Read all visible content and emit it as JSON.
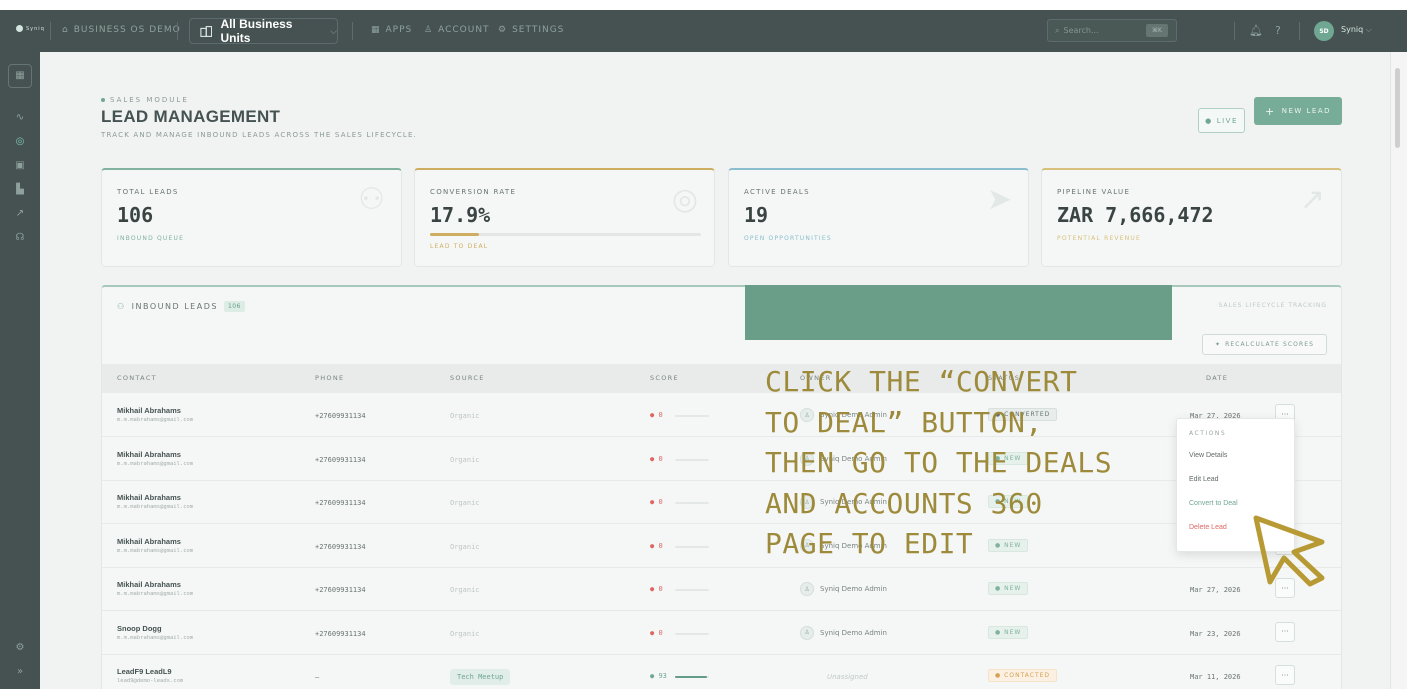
{
  "topbar": {
    "logo_text": "Syniq",
    "org_label": "BUSINESS OS DEMO",
    "business_unit": "All Business Units",
    "nav": [
      {
        "icon": "grid-icon",
        "label": "APPS"
      },
      {
        "icon": "user-icon",
        "label": "ACCOUNT"
      },
      {
        "icon": "gear-icon",
        "label": "SETTINGS"
      }
    ],
    "search_placeholder": "Search...",
    "search_shortcut": "⌘K",
    "avatar_initials": "SD",
    "user_name": "Syniq"
  },
  "sidebar": {
    "items": [
      "apps-grid-icon",
      "activity-icon",
      "target-icon",
      "wallet-icon",
      "chart-icon",
      "trend-icon",
      "headset-icon"
    ],
    "footer": [
      "gear-icon",
      "expand-icon"
    ]
  },
  "page": {
    "eyebrow": "SALES MODULE",
    "title": "LEAD MANAGEMENT",
    "subtitle": "TRACK AND MANAGE INBOUND LEADS ACROSS THE SALES LIFECYCLE.",
    "live_label": "LIVE",
    "new_lead_label": "NEW LEAD"
  },
  "stats": [
    {
      "label": "TOTAL LEADS",
      "value": "106",
      "caption": "INBOUND QUEUE",
      "accent": "#6fa892",
      "icon": "users-icon"
    },
    {
      "label": "CONVERSION RATE",
      "value": "17.9%",
      "caption": "LEAD TO DEAL",
      "accent": "#c8a24a",
      "icon": "target-icon",
      "progress": 0.179
    },
    {
      "label": "ACTIVE DEALS",
      "value": "19",
      "caption": "OPEN OPPORTUNITIES",
      "accent": "#7ab4c8",
      "icon": "cursor-icon"
    },
    {
      "label": "PIPELINE VALUE",
      "value": "ZAR 7,666,472",
      "caption": "POTENTIAL REVENUE",
      "accent": "#d3b86a",
      "icon": "trend-icon"
    }
  ],
  "leads_panel": {
    "title": "INBOUND LEADS",
    "count": "106",
    "right_label": "SALES LIFECYCLE TRACKING",
    "recalc_label": "RECALCULATE SCORES",
    "columns": [
      "CONTACT",
      "PHONE",
      "SOURCE",
      "SCORE",
      "OWNER",
      "STATUS",
      "DATE"
    ],
    "rows": [
      {
        "name": "Mikhail Abrahams",
        "email": "m.m.mabrahams@gmail.com",
        "phone": "+27609931134",
        "source": "Organic",
        "score": "0",
        "score_pct": 0,
        "owner": "Syniq Demo Admin",
        "status": "CONVERTED",
        "status_type": "conv",
        "date": "Mar 27, 2026"
      },
      {
        "name": "Mikhail Abrahams",
        "email": "m.m.mabrahams@gmail.com",
        "phone": "+27609931134",
        "source": "Organic",
        "score": "0",
        "score_pct": 0,
        "owner": "Syniq Demo Admin",
        "status": "NEW",
        "status_type": "new",
        "date": ""
      },
      {
        "name": "Mikhail Abrahams",
        "email": "m.m.mabrahams@gmail.com",
        "phone": "+27609931134",
        "source": "Organic",
        "score": "0",
        "score_pct": 0,
        "owner": "Syniq Demo Admin",
        "status": "NEW",
        "status_type": "new",
        "date": ""
      },
      {
        "name": "Mikhail Abrahams",
        "email": "m.m.mabrahams@gmail.com",
        "phone": "+27609931134",
        "source": "Organic",
        "score": "0",
        "score_pct": 0,
        "owner": "Syniq Demo Admin",
        "status": "NEW",
        "status_type": "new",
        "date": ""
      },
      {
        "name": "Mikhail Abrahams",
        "email": "m.m.mabrahams@gmail.com",
        "phone": "+27609931134",
        "source": "Organic",
        "score": "0",
        "score_pct": 0,
        "owner": "Syniq Demo Admin",
        "status": "NEW",
        "status_type": "new",
        "date": "Mar 27, 2026"
      },
      {
        "name": "Snoop Dogg",
        "email": "m.m.mabrahams@gmail.com",
        "phone": "+27609931134",
        "source": "Organic",
        "score": "0",
        "score_pct": 0,
        "owner": "Syniq Demo Admin",
        "status": "NEW",
        "status_type": "new",
        "date": "Mar 23, 2026"
      },
      {
        "name": "LeadF9 LeadL9",
        "email": "lead9@demo-leads.com",
        "phone": "–",
        "source": "Tech Meetup",
        "source_tag": true,
        "score": "93",
        "score_pct": 0.93,
        "owner": "Unassigned",
        "owner_unassigned": true,
        "status": "CONTACTED",
        "status_type": "cont",
        "date": "Mar 11, 2026"
      }
    ]
  },
  "actions_menu": {
    "header": "ACTIONS",
    "items": [
      "View Details",
      "Edit Lead",
      "Convert to Deal",
      "Delete Lead"
    ]
  },
  "instruction": {
    "text": "CLICK THE “CONVERT\nTO DEAL” BUTTON,\nTHEN GO TO THE DEALS\nAND ACCOUNTS 360\nPAGE TO EDIT",
    "color": "#9d8a3a"
  }
}
